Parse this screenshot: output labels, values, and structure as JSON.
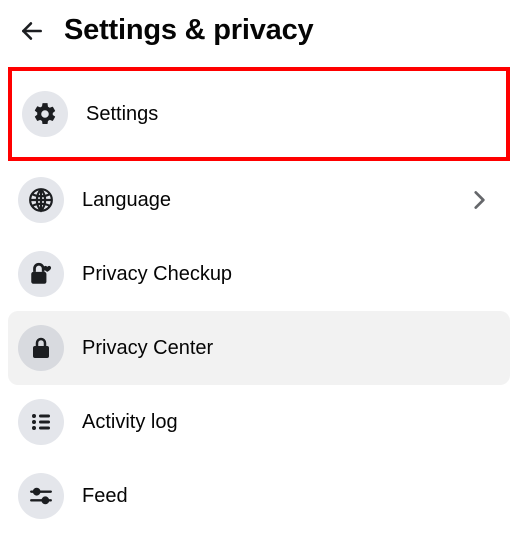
{
  "header": {
    "title": "Settings & privacy"
  },
  "menu": {
    "items": [
      {
        "label": "Settings",
        "icon": "gear-icon",
        "highlight": true,
        "hover": false,
        "chevron": false
      },
      {
        "label": "Language",
        "icon": "globe-icon",
        "highlight": false,
        "hover": false,
        "chevron": true
      },
      {
        "label": "Privacy Checkup",
        "icon": "lock-heart-icon",
        "highlight": false,
        "hover": false,
        "chevron": false
      },
      {
        "label": "Privacy Center",
        "icon": "lock-icon",
        "highlight": false,
        "hover": true,
        "chevron": false
      },
      {
        "label": "Activity log",
        "icon": "list-icon",
        "highlight": false,
        "hover": false,
        "chevron": false
      },
      {
        "label": "Feed",
        "icon": "sliders-icon",
        "highlight": false,
        "hover": false,
        "chevron": false
      }
    ]
  }
}
